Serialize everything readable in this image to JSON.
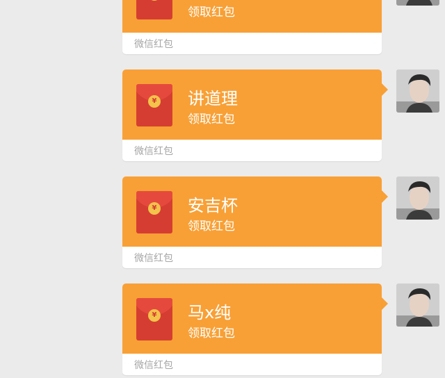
{
  "messages": [
    {
      "title": "",
      "subtitle": "领取红包",
      "footer": "微信红包",
      "coin": "¥"
    },
    {
      "title": "讲道理",
      "subtitle": "领取红包",
      "footer": "微信红包",
      "coin": "¥"
    },
    {
      "title": "安吉杯",
      "subtitle": "领取红包",
      "footer": "微信红包",
      "coin": "¥"
    },
    {
      "title": "马x纯",
      "subtitle": "领取红包",
      "footer": "微信红包",
      "coin": "¥"
    }
  ],
  "colors": {
    "background": "#ebebeb",
    "packet_orange": "#f8a036",
    "envelope_red": "#d53d32",
    "coin_gold": "#f3c34b",
    "footer_text": "#a6a6a6"
  },
  "icons": {
    "envelope": "red-envelope-icon",
    "avatar": "user-avatar"
  }
}
